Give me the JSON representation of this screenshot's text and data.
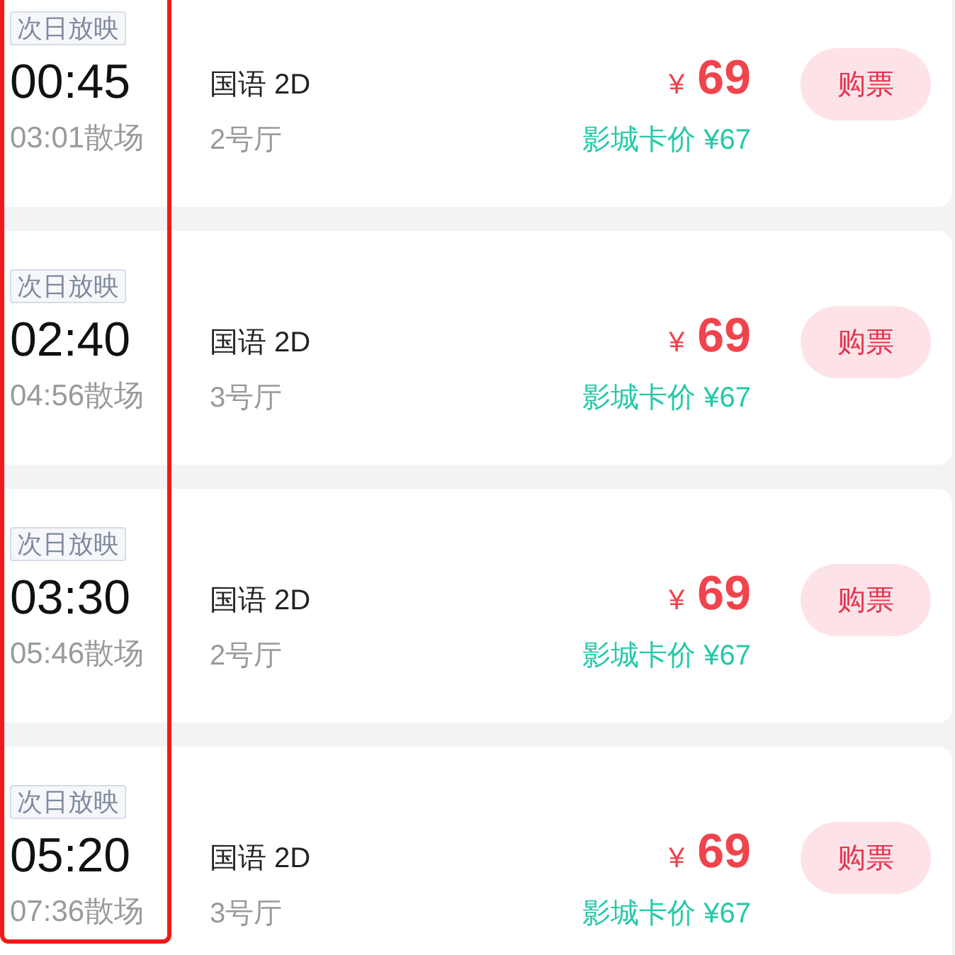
{
  "highlight_frame": true,
  "showtimes": [
    {
      "tag": "次日放映",
      "start": "00:45",
      "end": "03:01散场",
      "version": "国语 2D",
      "hall": "2号厅",
      "currency": "¥",
      "price": "69",
      "card_price": "影城卡价 ¥67",
      "button": "购票"
    },
    {
      "tag": "次日放映",
      "start": "02:40",
      "end": "04:56散场",
      "version": "国语 2D",
      "hall": "3号厅",
      "currency": "¥",
      "price": "69",
      "card_price": "影城卡价 ¥67",
      "button": "购票"
    },
    {
      "tag": "次日放映",
      "start": "03:30",
      "end": "05:46散场",
      "version": "国语 2D",
      "hall": "2号厅",
      "currency": "¥",
      "price": "69",
      "card_price": "影城卡价 ¥67",
      "button": "购票"
    },
    {
      "tag": "次日放映",
      "start": "05:20",
      "end": "07:36散场",
      "version": "国语 2D",
      "hall": "3号厅",
      "currency": "¥",
      "price": "69",
      "card_price": "影城卡价 ¥67",
      "button": "购票"
    }
  ]
}
